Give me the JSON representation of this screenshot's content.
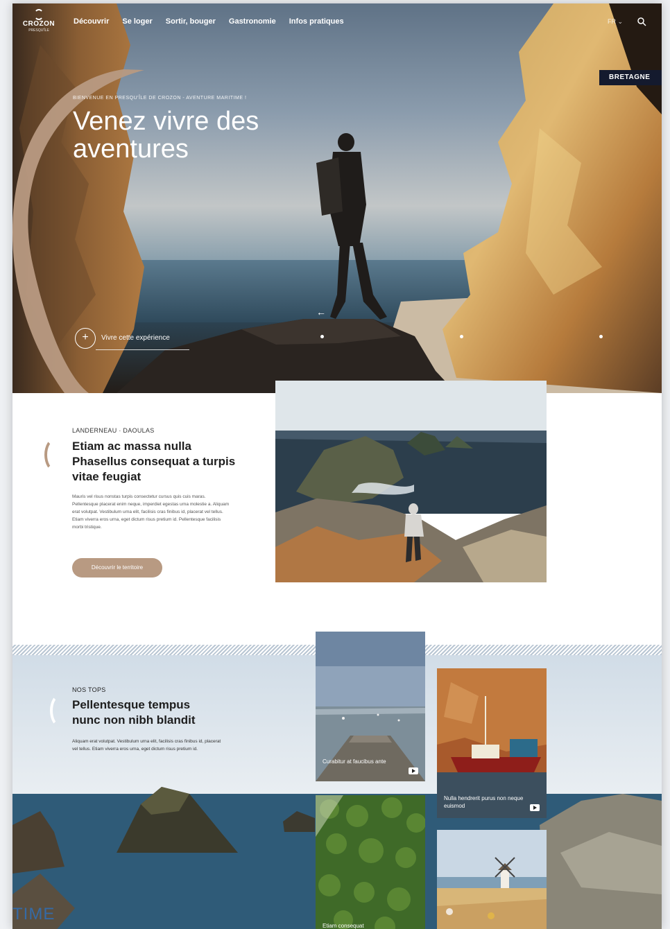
{
  "brand": {
    "name": "CROZON",
    "sub": "PRESQU'ÎLE"
  },
  "nav": {
    "items": [
      {
        "label": "Découvrir"
      },
      {
        "label": "Se loger"
      },
      {
        "label": "Sortir, bouger"
      },
      {
        "label": "Gastronomie"
      },
      {
        "label": "Infos pratiques"
      }
    ],
    "language": "FR ⌄"
  },
  "region_badge": "BRETAGNE",
  "hero": {
    "kicker": "BIENVENUE EN PRESQU'ÎLE DE CROZON - AVENTURE MARITIME !",
    "title": "Venez vivre des aventures",
    "cta_label": "Vivre cette expérience",
    "cta_icon": "+",
    "prev_arrow": "←"
  },
  "intro": {
    "kicker": "LANDERNEAU · DAOULAS",
    "title_bold": "Etiam ac massa nulla",
    "title_rest": "Phasellus consequat a turpis vitae feugiat",
    "body": "Mauris vel risus nonstas turpis consectetur cursus quis cuis maras. Pellentesque placerat enim neque, imperdiet egestas urna molestie a. Aliquam erat volutpat. Vestibulum urna elit, facilisis cras finibus id, placerat vel tellus. Etiam viverra eros urna, eget dictum risus pretium id. Pellentesque facilisis morbi tristique.",
    "button": "Découvrir le territoire"
  },
  "tops": {
    "kicker": "NOS TOPS",
    "title_bold_1": "Pellentesque tempus",
    "title_bold_2": "nunc",
    "title_rest": " non nibh blandit",
    "body": "Aliquam erat volutpat. Vestibulum urna elit, facilisis cras finibus id, placerat vel tellus. Etiam viverra eros urna, eget dictum risus pretium id.",
    "cards": [
      {
        "caption": "Curabitur at faucibus ante"
      },
      {
        "caption": "Nulla hendrerit purus non neque euismod"
      },
      {
        "caption": "Etiam consequat"
      }
    ]
  },
  "watermark": "TIME",
  "colors": {
    "accent": "#b89a82",
    "badge": "#141a2e",
    "stripe": "#b9c6d3"
  }
}
